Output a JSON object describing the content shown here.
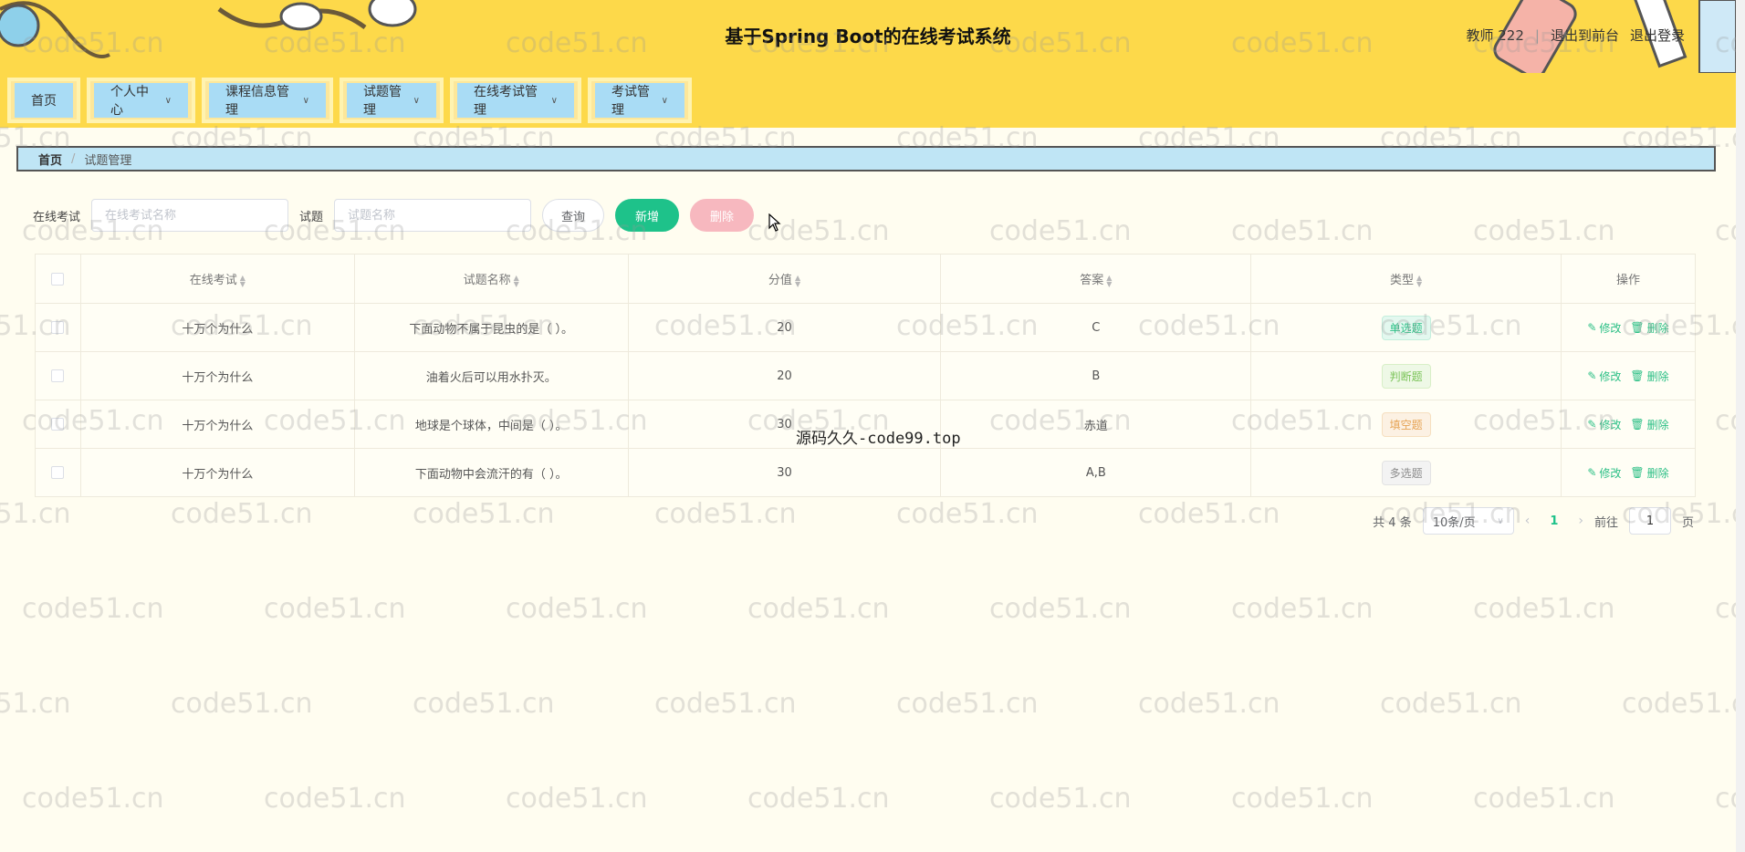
{
  "header": {
    "title": "基于Spring Boot的在线考试系统",
    "user": "教师 222",
    "links": [
      "退出到前台",
      "退出登录"
    ]
  },
  "nav": {
    "items": [
      {
        "label": "首页",
        "has_menu": false
      },
      {
        "label": "个人中心",
        "has_menu": true
      },
      {
        "label": "课程信息管理",
        "has_menu": true
      },
      {
        "label": "试题管理",
        "has_menu": true
      },
      {
        "label": "在线考试管理",
        "has_menu": true
      },
      {
        "label": "考试管理",
        "has_menu": true
      }
    ]
  },
  "breadcrumb": {
    "home": "首页",
    "current": "试题管理"
  },
  "search": {
    "exam_label": "在线考试",
    "exam_placeholder": "在线考试名称",
    "question_label": "试题",
    "question_placeholder": "试题名称",
    "query_label": "查询",
    "add_label": "新增",
    "delete_label": "删除"
  },
  "table": {
    "headers": [
      "在线考试",
      "试题名称",
      "分值",
      "答案",
      "类型",
      "操作"
    ],
    "rows": [
      {
        "exam": "十万个为什么",
        "question": "下面动物不属于昆虫的是（ ）。",
        "score": "20",
        "answer": "C",
        "type": "单选题",
        "type_color": "green"
      },
      {
        "exam": "十万个为什么",
        "question": "油着火后可以用水扑灭。",
        "score": "20",
        "answer": "B",
        "type": "判断题",
        "type_color": "lime"
      },
      {
        "exam": "十万个为什么",
        "question": "地球是个球体，中间是（ ）。",
        "score": "30",
        "answer": "赤道",
        "type": "填空题",
        "type_color": "orange"
      },
      {
        "exam": "十万个为什么",
        "question": "下面动物中会流汗的有（ ）。",
        "score": "30",
        "answer": "A,B",
        "type": "多选题",
        "type_color": "gray"
      }
    ],
    "edit_label": "修改",
    "delete_label": "删除"
  },
  "pagination": {
    "total": "共 4 条",
    "page_size": "10条/页",
    "current_page": "1",
    "goto_label": "前往",
    "goto_value": "1",
    "page_suffix": "页"
  },
  "watermark": "code51.cn",
  "overlay_text": "源码久久-code99.top",
  "colors": {
    "header_bg": "#fdd94a",
    "accent": "#1ec28a",
    "danger_light": "#f7b8bf",
    "nav_tab": "#a9dcf5"
  }
}
